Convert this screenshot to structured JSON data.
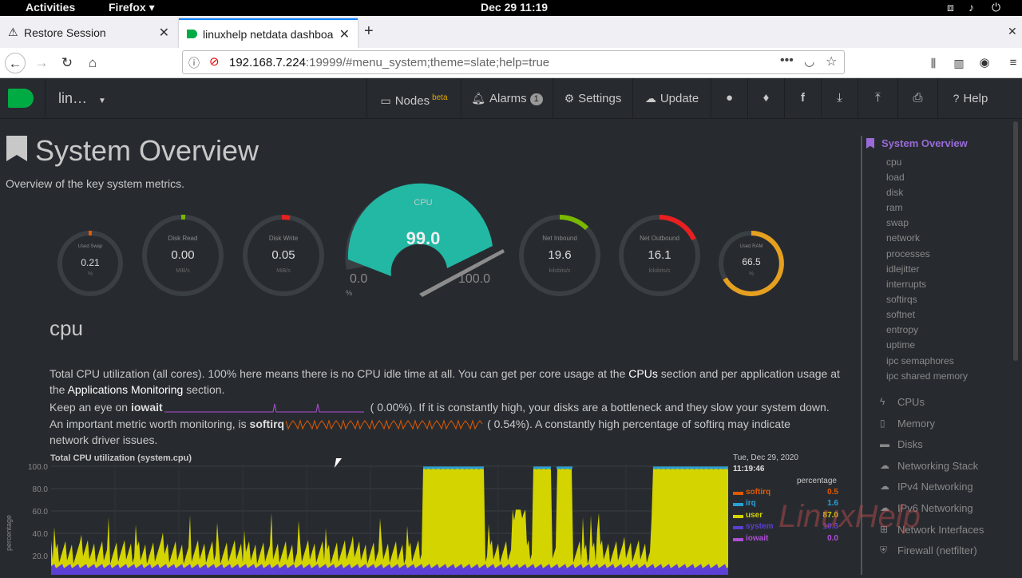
{
  "system_bar": {
    "activities": "Activities",
    "app": "Firefox ▾",
    "clock": "Dec 29  11:19"
  },
  "tabs": [
    {
      "label": "Restore Session"
    },
    {
      "label": "linuxhelp netdata dashboard"
    }
  ],
  "url": {
    "host": "192.168.7.224",
    "rest": ":19999/#menu_system;theme=slate;help=true"
  },
  "header": {
    "host": "lin…",
    "nodes": "Nodes",
    "nodes_beta": "beta",
    "alarms": "Alarms",
    "alarms_count": "1",
    "settings": "Settings",
    "update": "Update",
    "help": "Help"
  },
  "page": {
    "title": "System Overview",
    "subtitle": "Overview of the key system metrics."
  },
  "gauges": [
    {
      "title": "Used Swap",
      "value": "0.21",
      "unit": "%"
    },
    {
      "title": "Disk Read",
      "value": "0.00",
      "unit": "MiB/s"
    },
    {
      "title": "Disk Write",
      "value": "0.05",
      "unit": "MiB/s"
    },
    {
      "title": "CPU",
      "value": "99.0",
      "min": "0.0",
      "max": "100.0",
      "unit": "%"
    },
    {
      "title": "Net Inbound",
      "value": "19.6",
      "unit": "kilobits/s"
    },
    {
      "title": "Net Outbound",
      "value": "16.1",
      "unit": "kilobits/s"
    },
    {
      "title": "Used RAM",
      "value": "66.5",
      "unit": "%"
    }
  ],
  "cpu_section": {
    "heading": "cpu",
    "p1a": "Total CPU utilization (all cores). 100% here means there is no CPU idle time at all. You can get per core usage at the ",
    "p1_link1": "CPUs",
    "p1b": " section and per application usage at",
    "p2a": "the ",
    "p2_link": "Applications Monitoring",
    "p2b": " section.",
    "p3a": "Keep an eye on ",
    "p3_bold": "iowait",
    "p3_val": "(       0.00%). If it is constantly high, your disks are a bottleneck and they slow your system down.",
    "p4a": "An important metric worth monitoring, is ",
    "p4_bold": "softirq",
    "p4_val": "(       0.54%). A constantly high percentage of softirq may indicate",
    "p5": "network driver issues."
  },
  "chart_data": {
    "type": "area",
    "title": "Total CPU utilization (system.cpu)",
    "ylabel": "percentage",
    "yticks": [
      "100.0",
      "80.0",
      "60.0",
      "40.0",
      "20.0"
    ],
    "ylim": [
      0,
      100
    ],
    "legend_date": "Tue, Dec 29, 2020",
    "legend_time": "11:19:46",
    "legend_unit": "percentage",
    "series": [
      {
        "name": "softirq",
        "value": "0.5",
        "color": "#e05a00"
      },
      {
        "name": "irq",
        "value": "1.6",
        "color": "#2a9fd6"
      },
      {
        "name": "user",
        "value": "87.0",
        "color": "#d4d400"
      },
      {
        "name": "system",
        "value": "10.3",
        "color": "#5c3fd4"
      },
      {
        "name": "iowait",
        "value": "0.0",
        "color": "#b04fd4"
      }
    ]
  },
  "sidebar": {
    "current": "System Overview",
    "items": [
      "cpu",
      "load",
      "disk",
      "ram",
      "swap",
      "network",
      "processes",
      "idlejitter",
      "interrupts",
      "softirqs",
      "softnet",
      "entropy",
      "uptime",
      "ipc semaphores",
      "ipc shared memory"
    ],
    "sections": [
      "CPUs",
      "Memory",
      "Disks",
      "Networking Stack",
      "IPv4 Networking",
      "IPv6 Networking",
      "Network Interfaces",
      "Firewall (netfilter)"
    ]
  },
  "watermark": "LinuxHelp"
}
